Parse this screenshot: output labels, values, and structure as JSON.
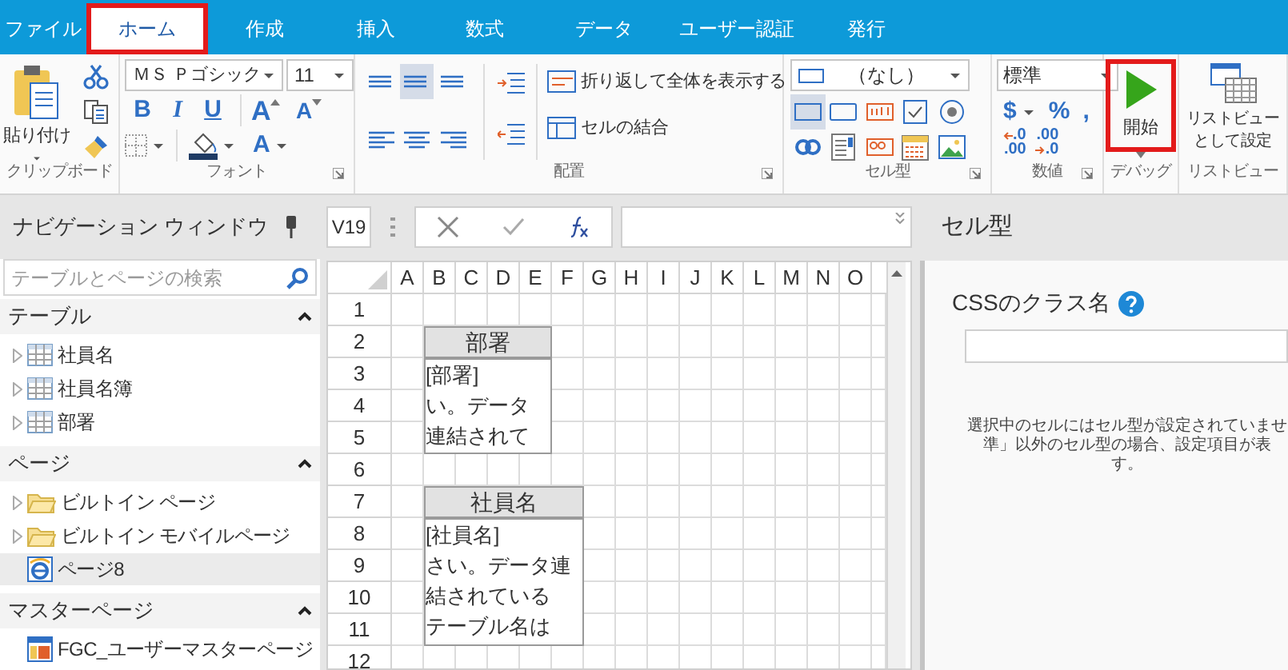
{
  "tabs": [
    {
      "label": "ファイル",
      "selected": false,
      "highlighted": false
    },
    {
      "label": "ホーム",
      "selected": true,
      "highlighted": true
    },
    {
      "label": "作成",
      "selected": false,
      "highlighted": false
    },
    {
      "label": "挿入",
      "selected": false,
      "highlighted": false
    },
    {
      "label": "数式",
      "selected": false,
      "highlighted": false
    },
    {
      "label": "データ",
      "selected": false,
      "highlighted": false
    },
    {
      "label": "ユーザー認証",
      "selected": false,
      "highlighted": false
    },
    {
      "label": "発行",
      "selected": false,
      "highlighted": false
    }
  ],
  "ribbon": {
    "clipboard": {
      "paste_label": "貼り付け",
      "group_label": "クリップボード"
    },
    "font": {
      "font_name": "ＭＳ Ｐゴシック",
      "font_size": "11",
      "bold": "B",
      "italic": "I",
      "underline": "U",
      "grow": "A",
      "shrink": "A",
      "font_color": "A",
      "group_label": "フォント"
    },
    "alignment": {
      "align_buttons": [
        {
          "kind": "top",
          "selected": false
        },
        {
          "kind": "middle",
          "selected": true
        },
        {
          "kind": "bottom",
          "selected": false
        },
        {
          "kind": "left",
          "selected": false
        },
        {
          "kind": "center",
          "selected": false
        },
        {
          "kind": "right",
          "selected": false
        }
      ],
      "wrap_label": "折り返して全体を表示する",
      "merge_label": "セルの結合",
      "group_label": "配置"
    },
    "cell_type": {
      "value": "（なし）",
      "buttons": [
        {
          "kind": "none",
          "selected": true
        },
        {
          "kind": "button",
          "selected": false
        },
        {
          "kind": "textbox",
          "selected": false
        },
        {
          "kind": "checkbox",
          "selected": false
        },
        {
          "kind": "radio",
          "selected": false
        },
        {
          "kind": "link",
          "selected": false
        },
        {
          "kind": "list",
          "selected": false
        },
        {
          "kind": "numeric",
          "selected": false
        },
        {
          "kind": "calendar",
          "selected": false
        },
        {
          "kind": "image",
          "selected": false
        }
      ],
      "group_label": "セル型"
    },
    "number": {
      "format": "標準",
      "currency": "$",
      "percent": "%",
      "comma": ",",
      "increase_decimal": [
        ".0",
        ".00"
      ],
      "decrease_decimal": [
        ".00",
        ".0"
      ],
      "group_label": "数値"
    },
    "debug": {
      "start_label": "開始",
      "highlighted": true,
      "group_label": "デバッグ"
    },
    "list_view": {
      "label_lines": [
        "リストビュー",
        "として設定"
      ],
      "group_label": "リストビュー"
    }
  },
  "navigation": {
    "title": "ナビゲーション ウィンドウ",
    "search": {
      "placeholder": "テーブルとページの検索"
    },
    "sections": [
      {
        "title": "テーブル",
        "expanded": true,
        "items": [
          {
            "kind": "table",
            "label": "社員名",
            "expandable": true,
            "selected": false
          },
          {
            "kind": "table",
            "label": "社員名簿",
            "expandable": true,
            "selected": false
          },
          {
            "kind": "table",
            "label": "部署",
            "expandable": true,
            "selected": false
          }
        ]
      },
      {
        "title": "ページ",
        "expanded": true,
        "items": [
          {
            "kind": "folder",
            "label": "ビルトイン ページ",
            "expandable": true,
            "selected": false
          },
          {
            "kind": "folder",
            "label": "ビルトイン モバイルページ",
            "expandable": true,
            "selected": false
          },
          {
            "kind": "page",
            "label": "ページ8",
            "expandable": false,
            "selected": true
          }
        ]
      },
      {
        "title": "マスターページ",
        "expanded": true,
        "items": [
          {
            "kind": "master",
            "label": "FGC_ユーザーマスターページ",
            "expandable": false,
            "selected": false
          }
        ]
      }
    ]
  },
  "formula_bar": {
    "cell_address": "V19"
  },
  "sheet": {
    "columns": [
      "A",
      "B",
      "C",
      "D",
      "E",
      "F",
      "G",
      "H",
      "I",
      "J",
      "K",
      "L",
      "M",
      "N",
      "O"
    ],
    "rows": [
      "1",
      "2",
      "3",
      "4",
      "5",
      "6",
      "7",
      "8",
      "9",
      "10",
      "11",
      "12"
    ],
    "blocks": [
      {
        "kind": "header",
        "lines": [
          "部署"
        ]
      },
      {
        "kind": "body",
        "lines": [
          "[部署]",
          "い。データ",
          "連結されて"
        ]
      },
      {
        "kind": "header",
        "lines": [
          "社員名"
        ]
      },
      {
        "kind": "body",
        "lines": [
          "[社員名]",
          "さい。データ連",
          "結されている",
          "テーブル名は"
        ]
      }
    ]
  },
  "properties": {
    "title": "セル型",
    "css_class_label": "CSSのクラス名",
    "message_lines": [
      "選択中のセルにはセル型が設定されていませ",
      "準」以外のセル型の場合、設定項目が表",
      "す。"
    ]
  }
}
